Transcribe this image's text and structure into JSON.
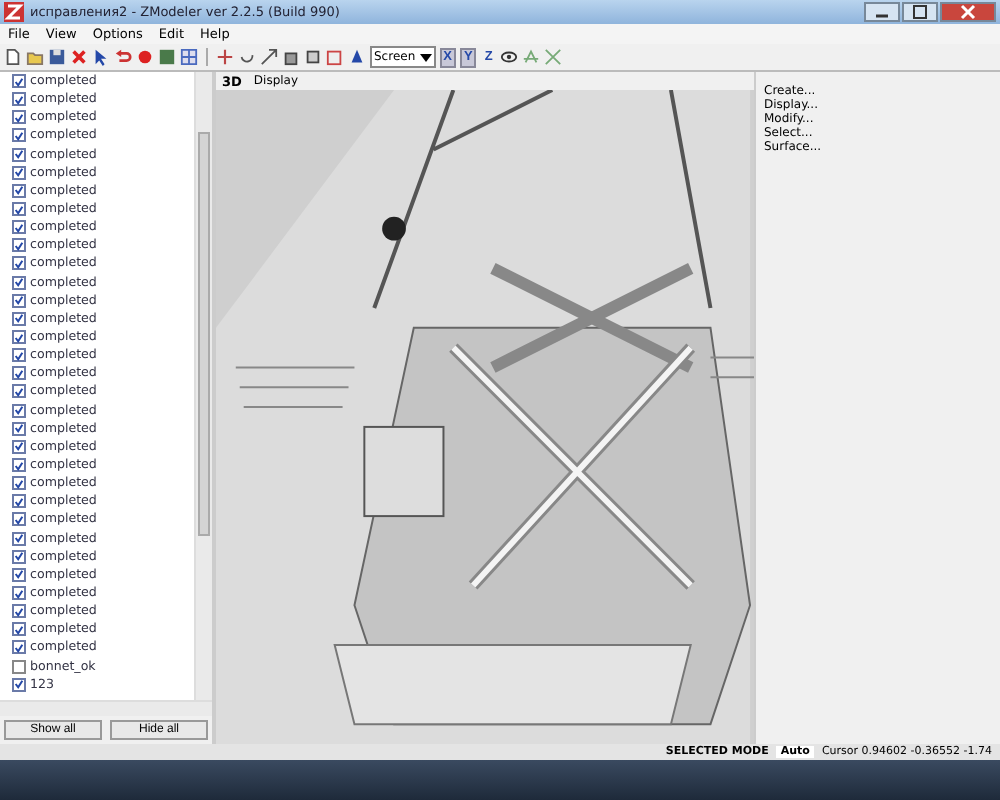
{
  "window": {
    "title": "исправления2 - ZModeler ver 2.2.5 (Build 990)"
  },
  "menu": [
    "File",
    "View",
    "Options",
    "Edit",
    "Help"
  ],
  "toolbar": {
    "view_dropdown": "Screen",
    "axes": [
      {
        "label": "X",
        "selected": true
      },
      {
        "label": "Y",
        "selected": true
      },
      {
        "label": "Z",
        "selected": false
      }
    ]
  },
  "objects": {
    "items": [
      {
        "label": "completed",
        "checked": true
      },
      {
        "label": "completed",
        "checked": true
      },
      {
        "label": "completed",
        "checked": true
      },
      {
        "label": "completed",
        "checked": true
      },
      {
        "label": "completed",
        "checked": true
      },
      {
        "label": "completed",
        "checked": true
      },
      {
        "label": "completed",
        "checked": true
      },
      {
        "label": "completed",
        "checked": true
      },
      {
        "label": "completed",
        "checked": true
      },
      {
        "label": "completed",
        "checked": true
      },
      {
        "label": "completed",
        "checked": true
      },
      {
        "label": "completed",
        "checked": true
      },
      {
        "label": "completed",
        "checked": true
      },
      {
        "label": "completed",
        "checked": true
      },
      {
        "label": "completed",
        "checked": true
      },
      {
        "label": "completed",
        "checked": true
      },
      {
        "label": "completed",
        "checked": true
      },
      {
        "label": "completed",
        "checked": true
      },
      {
        "label": "completed",
        "checked": true
      },
      {
        "label": "completed",
        "checked": true
      },
      {
        "label": "completed",
        "checked": true
      },
      {
        "label": "completed",
        "checked": true
      },
      {
        "label": "completed",
        "checked": true
      },
      {
        "label": "completed",
        "checked": true
      },
      {
        "label": "completed",
        "checked": true
      },
      {
        "label": "completed",
        "checked": true
      },
      {
        "label": "completed",
        "checked": true
      },
      {
        "label": "completed",
        "checked": true
      },
      {
        "label": "completed",
        "checked": true
      },
      {
        "label": "completed",
        "checked": true
      },
      {
        "label": "completed",
        "checked": true
      },
      {
        "label": "completed",
        "checked": true
      },
      {
        "label": "bonnet_ok",
        "checked": false
      },
      {
        "label": "123",
        "checked": true
      }
    ],
    "buttons": [
      "Show all",
      "Hide all"
    ]
  },
  "viewport": {
    "mode": "3D",
    "menu": "Display"
  },
  "commands": [
    "Create...",
    "Display...",
    "Modify...",
    "Select...",
    "Surface..."
  ],
  "status_bar": {
    "mode": "SELECTED MODE",
    "snap": "Auto",
    "cursor": "Cursor 0.94602 -0.36552 -1.74"
  }
}
